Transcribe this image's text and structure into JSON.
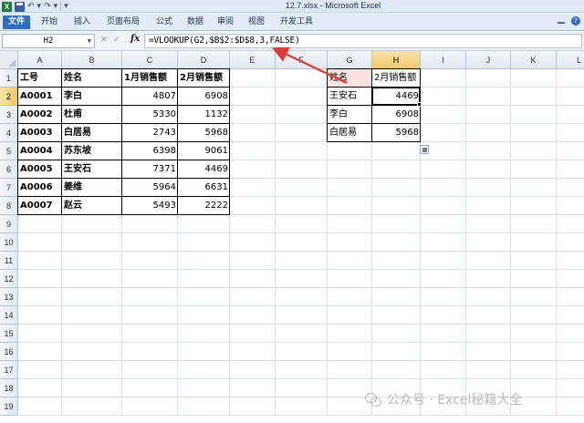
{
  "window": {
    "title": "12.7.xlsx - Microsoft Excel",
    "app_icon": "X",
    "undo_icon": "undo-icon",
    "redo_icon": "redo-icon"
  },
  "ribbon": {
    "tabs": [
      {
        "label": "文件",
        "active": true
      },
      {
        "label": "开始"
      },
      {
        "label": "插入"
      },
      {
        "label": "页面布局"
      },
      {
        "label": "公式"
      },
      {
        "label": "数据"
      },
      {
        "label": "审阅"
      },
      {
        "label": "视图"
      },
      {
        "label": "开发工具"
      }
    ],
    "help_label": "?"
  },
  "formula_bar": {
    "name_box": "H2",
    "fx_label": "fx",
    "formula": "=VLOOKUP(G2,$B$2:$D$8,3,FALSE)"
  },
  "columns": [
    "A",
    "B",
    "C",
    "D",
    "E",
    "F",
    "G",
    "H",
    "I",
    "J",
    "K",
    "L"
  ],
  "rows": [
    "1",
    "2",
    "3",
    "4",
    "5",
    "6",
    "7",
    "8",
    "9",
    "10",
    "11",
    "12",
    "13",
    "14",
    "15",
    "16",
    "17",
    "18",
    "19"
  ],
  "selected": {
    "column": "H",
    "row": "2"
  },
  "table1": {
    "headers": [
      "工号",
      "姓名",
      "1月销售额",
      "2月销售额"
    ],
    "rows": [
      [
        "A0001",
        "李白",
        "4807",
        "6908"
      ],
      [
        "A0002",
        "杜甫",
        "5330",
        "1132"
      ],
      [
        "A0003",
        "白居易",
        "2743",
        "5968"
      ],
      [
        "A0004",
        "苏东坡",
        "6398",
        "9061"
      ],
      [
        "A0005",
        "王安石",
        "7371",
        "4469"
      ],
      [
        "A0006",
        "姜维",
        "5964",
        "6631"
      ],
      [
        "A0007",
        "赵云",
        "5493",
        "2222"
      ]
    ]
  },
  "table2": {
    "headers": [
      "姓名",
      "2月销售额"
    ],
    "rows": [
      [
        "王安石",
        "4469"
      ],
      [
        "李白",
        "6908"
      ],
      [
        "白居易",
        "5968"
      ]
    ]
  },
  "colors": {
    "file_tab": "#2f6dc1",
    "arrow": "#e03a3a",
    "selected_header": "#f2c96a"
  },
  "watermark": {
    "text": "公众号 · Excel秘籍大全",
    "icon": "wechat-icon"
  }
}
